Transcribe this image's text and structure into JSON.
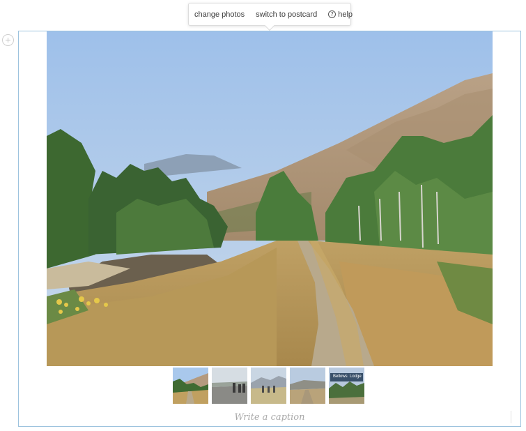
{
  "toolbar": {
    "change_photos": "change photos",
    "switch_to_postcard": "switch to postcard",
    "help": "help",
    "help_icon_glyph": "?"
  },
  "photo_block": {
    "main_photo": {
      "description_icon": "landscape-photo"
    },
    "thumbnails": [
      {
        "name": "thumb-1"
      },
      {
        "name": "thumb-2"
      },
      {
        "name": "thumb-3"
      },
      {
        "name": "thumb-4"
      },
      {
        "name": "thumb-5",
        "sign_left": "Bellows",
        "sign_right": "Lodge"
      }
    ],
    "caption_placeholder": "Write a caption"
  },
  "colors": {
    "frame_border": "#9cc3de",
    "sky": "#a9c8ec",
    "mountain": "#b59b7e",
    "trees": "#3f6b32",
    "grass": "#c8a560"
  }
}
